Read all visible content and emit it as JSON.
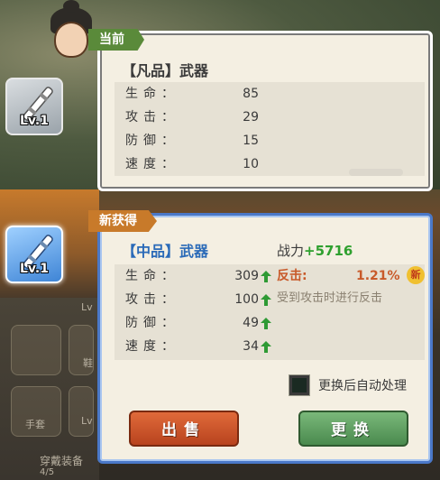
{
  "current": {
    "tag": "当前",
    "item_name": "【凡品】武器",
    "level": "Lv.1",
    "stats": [
      {
        "label": "生命：",
        "value": "85"
      },
      {
        "label": "攻击：",
        "value": "29"
      },
      {
        "label": "防御：",
        "value": "15"
      },
      {
        "label": "速度：",
        "value": "10"
      }
    ]
  },
  "new_item": {
    "tag": "新获得",
    "item_name": "【中品】武器",
    "level": "Lv.1",
    "power_label": "战力",
    "power_delta": "+5716",
    "stats": [
      {
        "label": "生命：",
        "value": "309"
      },
      {
        "label": "攻击：",
        "value": "100"
      },
      {
        "label": "防御：",
        "value": "49"
      },
      {
        "label": "速度：",
        "value": "34"
      }
    ],
    "skill": {
      "name": "反击:",
      "value": "1.21%",
      "badge": "新",
      "description": "受到攻击时进行反击"
    },
    "auto_process_label": "更换后自动处理",
    "auto_process_checked": true,
    "sell_label": "出售",
    "swap_label": "更换"
  },
  "background": {
    "slot_text_1": "鞋",
    "slot_text_2": "手套",
    "bottom_text": "穿戴装备",
    "bottom_count": "4/5",
    "lv_stub": "Lv"
  },
  "colors": {
    "current_tag": "#5a8a3a",
    "new_tag": "#c87a2a",
    "new_name": "#2a6ab8",
    "power_plus": "#2fa02f",
    "skill": "#c85a2a",
    "sell": "#d0562a",
    "swap": "#5e9e62"
  },
  "icons": [
    "weapon-icon",
    "up-arrow-icon",
    "hero-avatar"
  ]
}
